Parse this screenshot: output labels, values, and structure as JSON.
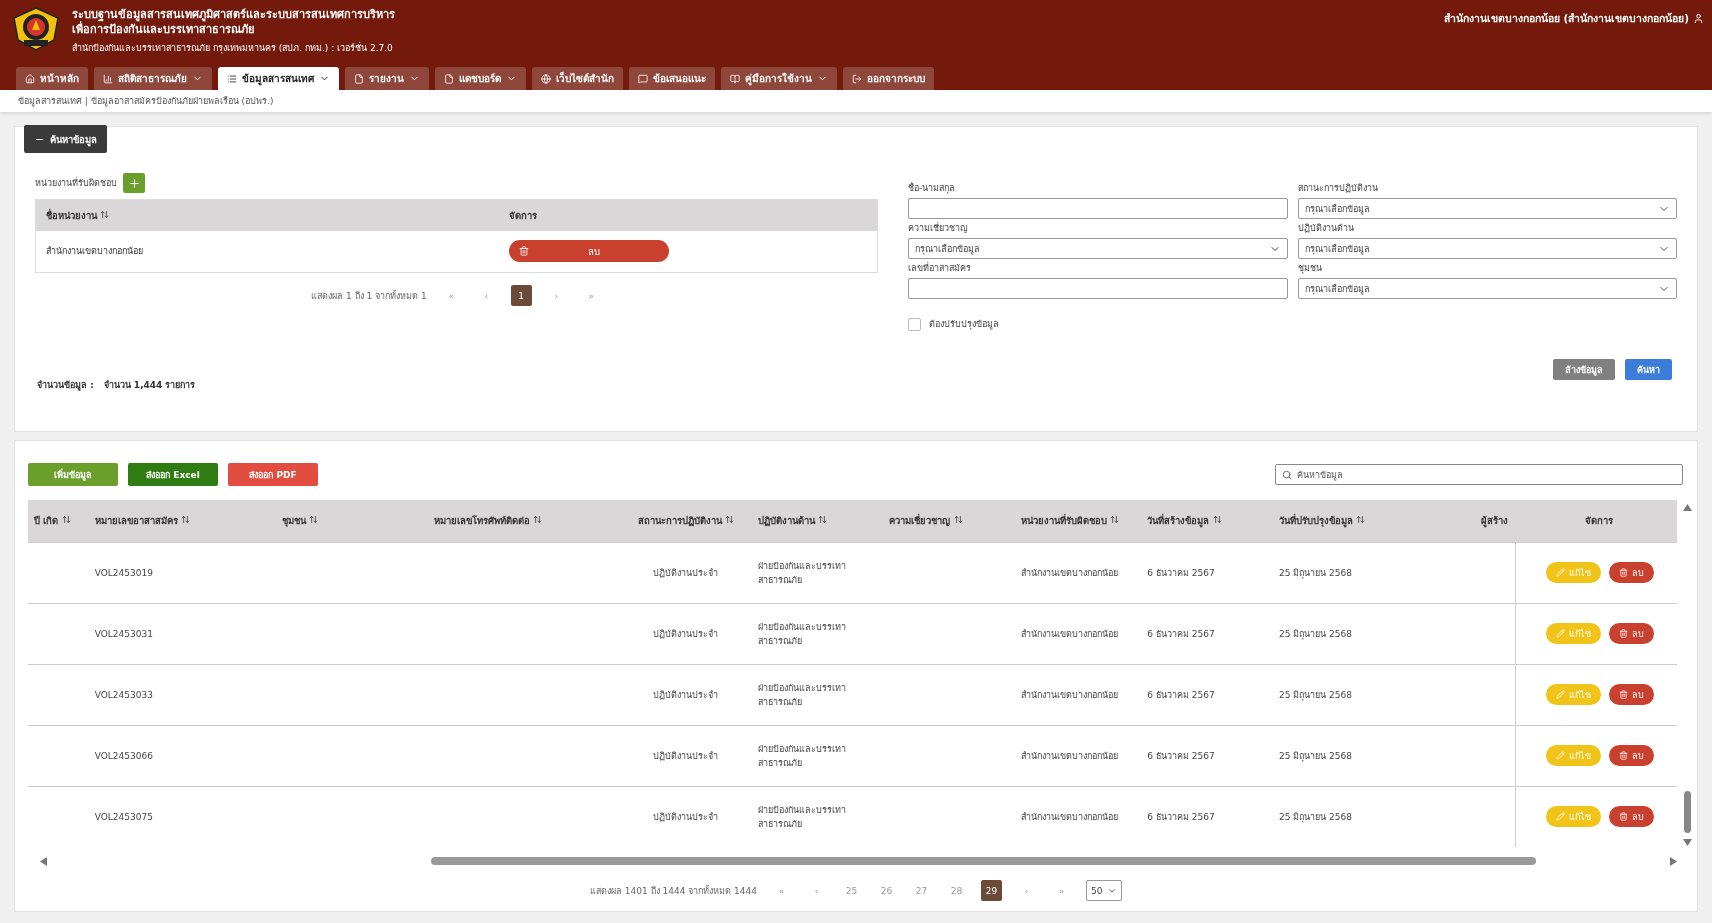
{
  "header": {
    "title_line_1": "ระบบฐานข้อมูลสารสนเทศภูมิศาสตร์และระบบสารสนเทศการบริหาร",
    "title_line_2": "เพื่อการป้องกันและบรรเทาสาธารณภัย",
    "subtitle": "สำนักป้องกันและบรรเทาสาธารณภัย กรุงเทพมหานคร (สปภ. กทม.) : เวอร์ชั่น 2.7.0",
    "user": "สำนักงานเขตบางกอกน้อย (สำนักงานเขตบางกอกน้อย)"
  },
  "nav_tabs": [
    {
      "kind": "home",
      "label": "หน้าหลัก",
      "dropdown": false,
      "selected": false
    },
    {
      "kind": "chart",
      "label": "สถิติสาธารณภัย",
      "dropdown": true,
      "selected": false
    },
    {
      "kind": "list",
      "label": "ข้อมูลสารสนเทศ",
      "dropdown": true,
      "selected": true
    },
    {
      "kind": "file",
      "label": "รายงาน",
      "dropdown": true,
      "selected": false
    },
    {
      "kind": "file",
      "label": "แดชบอร์ด",
      "dropdown": true,
      "selected": false
    },
    {
      "kind": "globe",
      "label": "เว็บไซต์สำนัก",
      "dropdown": false,
      "selected": false
    },
    {
      "kind": "chat",
      "label": "ข้อเสนอแนะ",
      "dropdown": false,
      "selected": false
    },
    {
      "kind": "book",
      "label": "คู่มือการใช้งาน",
      "dropdown": true,
      "selected": false
    },
    {
      "kind": "logout",
      "label": "ออกจากระบบ",
      "dropdown": false,
      "selected": false
    }
  ],
  "breadcrumb": "ข้อมูลสารสนเทศ | ข้อมูลอาสาสมัครป้องกันภัยฝ่ายพลเรือน (อปพร.)",
  "search_panel": {
    "toggle_label": "ค้นหาข้อมูล",
    "expanded": true,
    "unit_label": "หน่วยงานที่รับผิดชอบ",
    "unit_table": {
      "columns": [
        {
          "label": "ชื่อหน่วยงาน",
          "sortable": true
        },
        {
          "label": "จัดการ",
          "sortable": false
        }
      ],
      "rows": [
        {
          "name": "สำนักงานเขตบางกอกน้อย",
          "action": "ลบ"
        }
      ]
    },
    "unit_pagination": {
      "summary": "แสดงผล 1 ถึง 1 จากทั้งหมด 1",
      "first": "«",
      "prev": "‹",
      "pages": [
        {
          "label": "1",
          "selected": true
        }
      ],
      "next": "›",
      "last": "»"
    },
    "fields": [
      {
        "kind": "text",
        "label": "ชื่อ-นามสกุล"
      },
      {
        "kind": "select",
        "label": "สถานะการปฏิบัติงาน",
        "placeholder": "กรุณาเลือกข้อมูล"
      },
      {
        "kind": "select",
        "label": "ความเชี่ยวชาญ",
        "placeholder": "กรุณาเลือกข้อมูล"
      },
      {
        "kind": "select",
        "label": "ปฏิบัติงานด้าน",
        "placeholder": "กรุณาเลือกข้อมูล"
      },
      {
        "kind": "text",
        "label": "เลขที่อาสาสมัคร"
      },
      {
        "kind": "select",
        "label": "ชุมชน",
        "placeholder": "กรุณาเลือกข้อมูล"
      }
    ],
    "needs_update": {
      "label": "ต้องปรับปรุงข้อมูล",
      "checked": false
    },
    "clear_button": "ล้างข้อมูล",
    "search_button": "ค้นหา",
    "count_label": "จำนวนข้อมูล :",
    "count_value": "จำนวน 1,444 รายการ"
  },
  "toolbar": {
    "buttons": [
      {
        "kind": "add",
        "label": "เพิ่มข้อมูล"
      },
      {
        "kind": "excel",
        "label": "ส่งออก Excel"
      },
      {
        "kind": "pdf",
        "label": "ส่งออก PDF"
      }
    ],
    "search_placeholder": "ค้นหาข้อมูล"
  },
  "table": {
    "columns": [
      {
        "label": "ปี เกิด",
        "sortable": true
      },
      {
        "label": "หมายเลขอาสาสมัคร",
        "sortable": true
      },
      {
        "label": "ชุมชน",
        "sortable": true
      },
      {
        "label": "หมายเลขโทรศัพท์ติดต่อ",
        "sortable": true
      },
      {
        "label": "สถานะการปฏิบัติงาน",
        "sortable": true
      },
      {
        "label": "ปฏิบัติงานด้าน",
        "sortable": true
      },
      {
        "label": "ความเชี่ยวชาญ",
        "sortable": true
      },
      {
        "label": "หน่วยงานที่รับผิดชอบ",
        "sortable": true
      },
      {
        "label": "วันที่สร้างข้อมูล",
        "sortable": true
      },
      {
        "label": "วันที่ปรับปรุงข้อมูล",
        "sortable": true
      },
      {
        "label": "ผู้สร้าง",
        "sortable": false
      },
      {
        "label": "จัดการ",
        "sortable": false
      }
    ],
    "rows": [
      {
        "volunteer_no": "VOL2453019",
        "status": "ปฏิบัติงานประจำ",
        "side": "ฝ่ายป้องกันและบรรเทาสาธารณภัย",
        "unit": "สำนักงานเขตบางกอกน้อย",
        "created": "6 ธันวาคม 2567",
        "updated": "25 มิถุนายน 2568",
        "edit": "แก้ไข",
        "delete": "ลบ"
      },
      {
        "volunteer_no": "VOL2453031",
        "status": "ปฏิบัติงานประจำ",
        "side": "ฝ่ายป้องกันและบรรเทาสาธารณภัย",
        "unit": "สำนักงานเขตบางกอกน้อย",
        "created": "6 ธันวาคม 2567",
        "updated": "25 มิถุนายน 2568",
        "edit": "แก้ไข",
        "delete": "ลบ"
      },
      {
        "volunteer_no": "VOL2453033",
        "status": "ปฏิบัติงานประจำ",
        "side": "ฝ่ายป้องกันและบรรเทาสาธารณภัย",
        "unit": "สำนักงานเขตบางกอกน้อย",
        "created": "6 ธันวาคม 2567",
        "updated": "25 มิถุนายน 2568",
        "edit": "แก้ไข",
        "delete": "ลบ"
      },
      {
        "volunteer_no": "VOL2453066",
        "status": "ปฏิบัติงานประจำ",
        "side": "ฝ่ายป้องกันและบรรเทาสาธารณภัย",
        "unit": "สำนักงานเขตบางกอกน้อย",
        "created": "6 ธันวาคม 2567",
        "updated": "25 มิถุนายน 2568",
        "edit": "แก้ไข",
        "delete": "ลบ"
      },
      {
        "volunteer_no": "VOL2453075",
        "status": "ปฏิบัติงานประจำ",
        "side": "ฝ่ายป้องกันและบรรเทาสาธารณภัย",
        "unit": "สำนักงานเขตบางกอกน้อย",
        "created": "6 ธันวาคม 2567",
        "updated": "25 มิถุนายน 2568",
        "edit": "แก้ไข",
        "delete": "ลบ"
      }
    ]
  },
  "pagination": {
    "summary": "แสดงผล 1401 ถึง 1444 จากทั้งหมด 1444",
    "first": "«",
    "prev": "‹",
    "pages": [
      {
        "label": "25",
        "selected": false
      },
      {
        "label": "26",
        "selected": false
      },
      {
        "label": "27",
        "selected": false
      },
      {
        "label": "28",
        "selected": false
      },
      {
        "label": "29",
        "selected": true
      }
    ],
    "next": "›",
    "last": "»",
    "page_size": "50"
  }
}
